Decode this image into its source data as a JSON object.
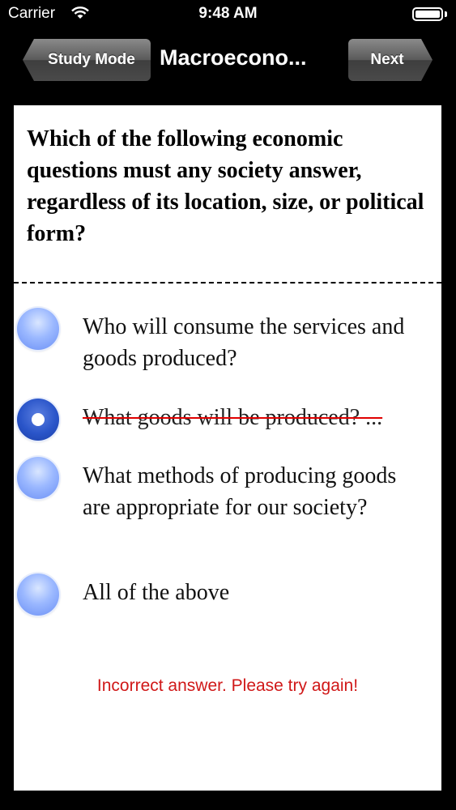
{
  "status_bar": {
    "carrier": "Carrier",
    "time": "9:48 AM",
    "icons": [
      "wifi-icon",
      "battery-icon"
    ]
  },
  "nav": {
    "back_label": "Study Mode",
    "title": "Macroecono...",
    "next_label": "Next"
  },
  "question": {
    "text": "Which of the following economic questions must any society answer, regardless of its location, size, or political form?"
  },
  "answers": [
    {
      "text": "Who will consume the services and goods produced?",
      "selected": false
    },
    {
      "text": "What goods will be produced? ...",
      "selected": true,
      "marked_incorrect": true
    },
    {
      "text": "What methods of producing goods are appropriate for our society?",
      "selected": false
    },
    {
      "text": "All of the above",
      "selected": false
    }
  ],
  "feedback": {
    "text": "Incorrect answer. Please try again!",
    "color": "#d01818"
  }
}
